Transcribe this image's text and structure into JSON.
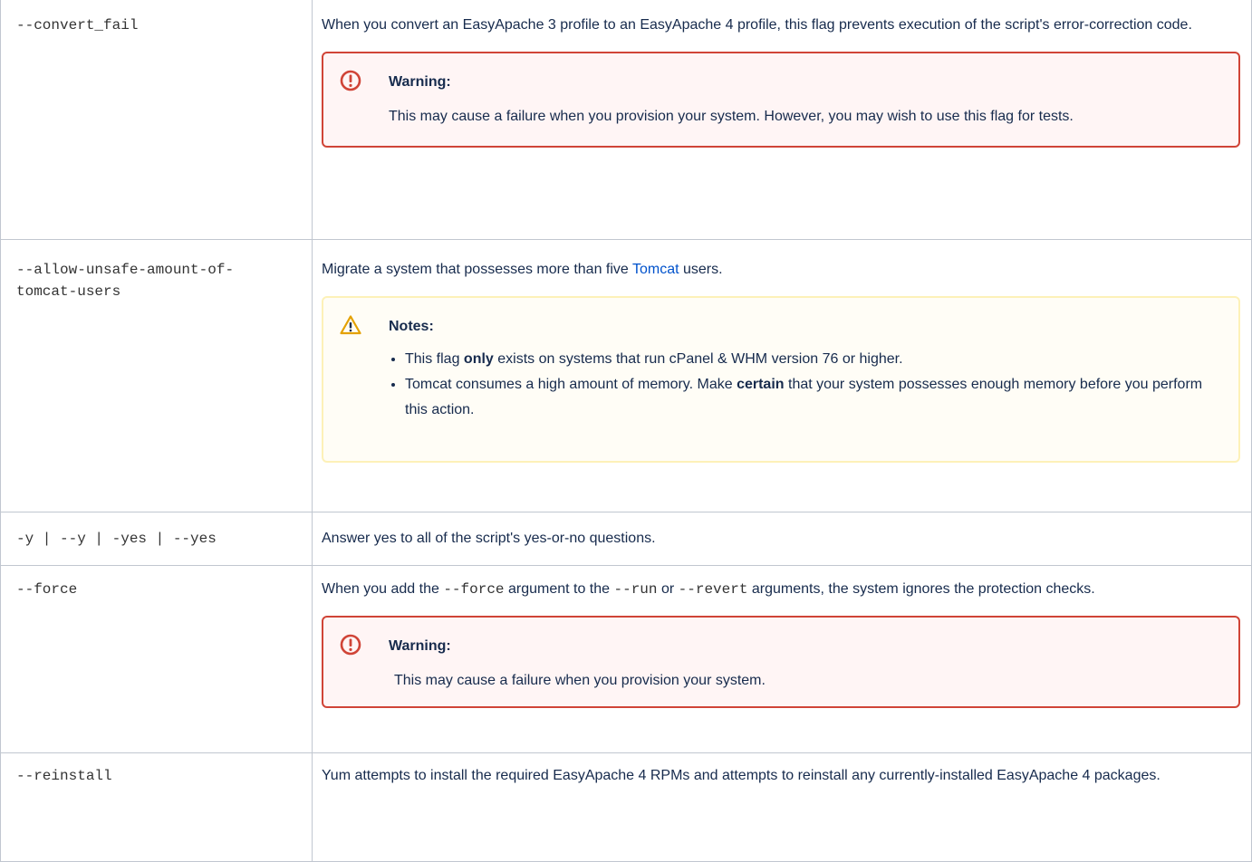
{
  "rows": [
    {
      "flag": "--convert_fail",
      "description": "When you convert an EasyApache 3 profile to an EasyApache 4 profile, this flag prevents execution of the script's error-correction code.",
      "panel": {
        "type": "warning",
        "title": "Warning:",
        "body": "This may cause a failure when you provision your system. However, you may wish to use this flag for tests."
      }
    },
    {
      "flag_line1": "--allow-unsafe-amount-of-",
      "flag_line2": "tomcat-users",
      "description_pre": "Migrate a system that possesses more than five ",
      "description_link": "Tomcat",
      "description_post": " users.",
      "panel": {
        "type": "note",
        "title": "Notes:",
        "bullets": [
          {
            "pre": "This flag ",
            "bold": "only",
            "post": " exists on systems that run cPanel & WHM version 76 or higher."
          },
          {
            "pre": "Tomcat consumes a high amount of memory. Make ",
            "bold": "certain",
            "post": " that your system possesses enough memory before you perform this action."
          }
        ]
      }
    },
    {
      "flag": "-y | --y | -yes | --yes",
      "description": "Answer yes to all of the script's yes-or-no questions."
    },
    {
      "flag": "--force",
      "desc_part1": "When you add the ",
      "desc_code1": "--force",
      "desc_part2": " argument to the ",
      "desc_code2": "--run",
      "desc_part3": " or ",
      "desc_code3": "--revert",
      "desc_part4": " arguments, the system ignores the protection checks.",
      "panel": {
        "type": "warning",
        "title": "Warning:",
        "body": "This may cause a failure when you provision your system."
      }
    },
    {
      "flag": "--reinstall",
      "description": "Yum attempts to install the required EasyApache 4 RPMs and attempts to reinstall any currently-installed EasyApache 4 packages."
    }
  ],
  "icons": {
    "warning": "error-circle-icon",
    "note": "warning-triangle-icon"
  },
  "colors": {
    "warning_border": "#d04437",
    "warning_bg": "#fff5f5",
    "note_border": "#fdf1b8",
    "note_bg": "#fffdf6",
    "link": "#0052cc"
  }
}
